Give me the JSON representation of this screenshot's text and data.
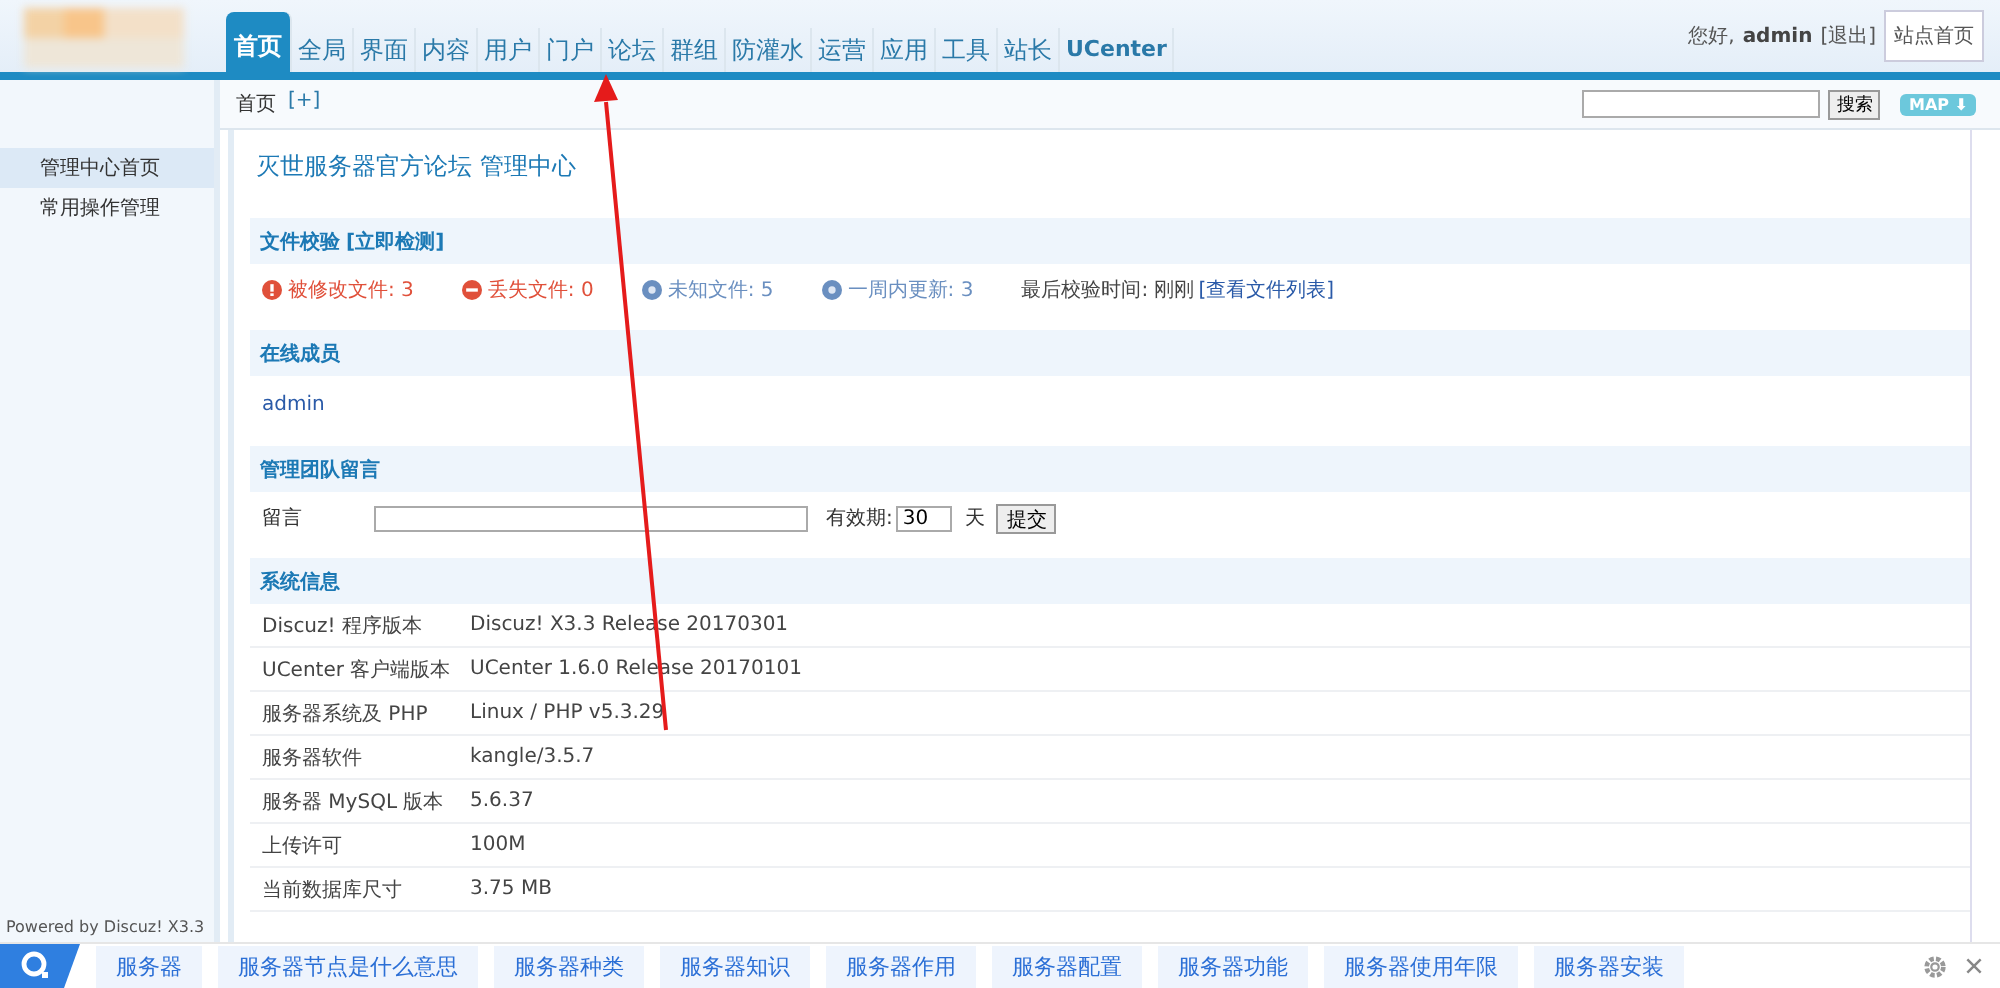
{
  "nav": {
    "tabs": [
      {
        "label": "首页",
        "selected": true
      },
      {
        "label": "全局",
        "selected": false
      },
      {
        "label": "界面",
        "selected": false
      },
      {
        "label": "内容",
        "selected": false
      },
      {
        "label": "用户",
        "selected": false
      },
      {
        "label": "门户",
        "selected": false
      },
      {
        "label": "论坛",
        "selected": false
      },
      {
        "label": "群组",
        "selected": false
      },
      {
        "label": "防灌水",
        "selected": false
      },
      {
        "label": "运营",
        "selected": false
      },
      {
        "label": "应用",
        "selected": false
      },
      {
        "label": "工具",
        "selected": false
      },
      {
        "label": "站长",
        "selected": false
      },
      {
        "label": "UCenter",
        "selected": false
      }
    ],
    "greeting": "您好, ",
    "user": "admin",
    "logout": "[退出]",
    "home_button": "站点首页"
  },
  "breadcrumb": {
    "items": [
      "首页",
      "[+]"
    ],
    "search_button": "搜索",
    "map_button": "MAP ⬇"
  },
  "sidebar": {
    "items": [
      {
        "label": "管理中心首页",
        "selected": true
      },
      {
        "label": "常用操作管理",
        "selected": false
      }
    ],
    "footer": "Powered by Discuz! X3.3"
  },
  "page_title": "灭世服务器官方论坛 管理中心",
  "file_check": {
    "title": "文件校验",
    "action": "[立即检测]",
    "stats": [
      {
        "kind": "error",
        "label": "被修改文件: 3"
      },
      {
        "kind": "missing",
        "label": "丢失文件: 0"
      },
      {
        "kind": "unknown",
        "label": "未知文件: 5"
      },
      {
        "kind": "unknown",
        "label": "一周内更新: 3"
      }
    ],
    "last_check": "最后校验时间: 刚刚",
    "list_link": "[查看文件列表]"
  },
  "online": {
    "title": "在线成员",
    "members": [
      "admin"
    ]
  },
  "team_message": {
    "title": "管理团队留言",
    "label": "留言",
    "validity_label": "有效期:",
    "validity_value": "30",
    "unit": "天",
    "submit": "提交"
  },
  "system_info": {
    "title": "系统信息",
    "rows": [
      {
        "label": "Discuz! 程序版本",
        "value": "Discuz! X3.3 Release 20170301"
      },
      {
        "label": "UCenter 客户端版本",
        "value": "UCenter 1.6.0 Release 20170101"
      },
      {
        "label": "服务器系统及 PHP",
        "value": "Linux / PHP v5.3.29"
      },
      {
        "label": "服务器软件",
        "value": "kangle/3.5.7"
      },
      {
        "label": "服务器 MySQL 版本",
        "value": "5.6.37"
      },
      {
        "label": "上传许可",
        "value": "100M"
      },
      {
        "label": "当前数据库尺寸",
        "value": "3.75 MB"
      }
    ]
  },
  "bottom_bar": {
    "links": [
      "服务器",
      "服务器节点是什么意思",
      "服务器种类",
      "服务器知识",
      "服务器作用",
      "服务器配置",
      "服务器功能",
      "服务器使用年限",
      "服务器安装"
    ]
  }
}
